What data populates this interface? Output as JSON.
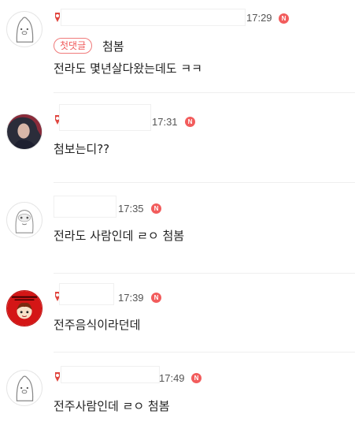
{
  "comments": [
    {
      "time": "17:29",
      "n": "N",
      "tag": "첫댓글",
      "tag_text": "첨봄",
      "text": "전라도 몇년살다왔는데도 ㅋㅋ"
    },
    {
      "time": "17:31",
      "n": "N",
      "text": "첨보는디??"
    },
    {
      "time": "17:35",
      "n": "N",
      "text": "전라도 사람인데 ㄹㅇ 첨봄"
    },
    {
      "time": "17:39",
      "n": "N",
      "text": "전주음식이라던데"
    },
    {
      "time": "17:49",
      "n": "N",
      "text": "전주사람인데 ㄹㅇ 첨봄"
    }
  ],
  "colors": {
    "accent": "#f25c5c",
    "badge": "#e0463f"
  }
}
